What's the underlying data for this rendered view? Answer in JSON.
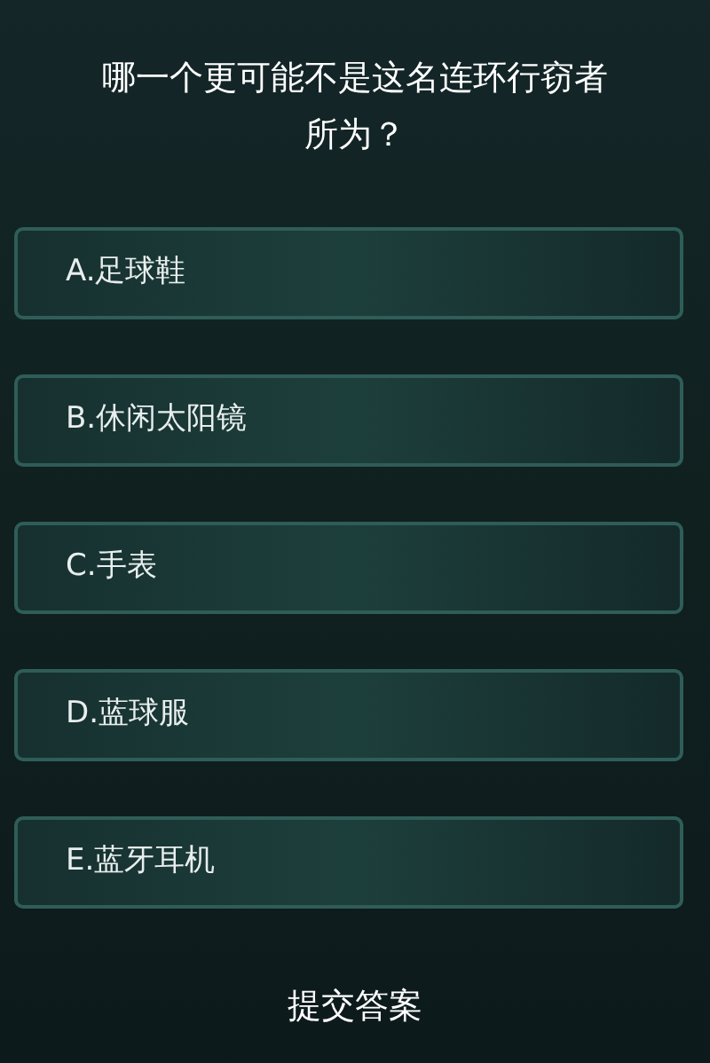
{
  "question": "哪一个更可能不是这名连环行窃者所为？",
  "options": [
    {
      "label": "A.足球鞋",
      "selected": false
    },
    {
      "label": "B.休闲太阳镜",
      "selected": false
    },
    {
      "label": "C.手表",
      "selected": false
    },
    {
      "label": "D.蓝球服",
      "selected": false
    },
    {
      "label": "E.蓝牙耳机",
      "selected": false
    }
  ],
  "submit": "提交答案"
}
